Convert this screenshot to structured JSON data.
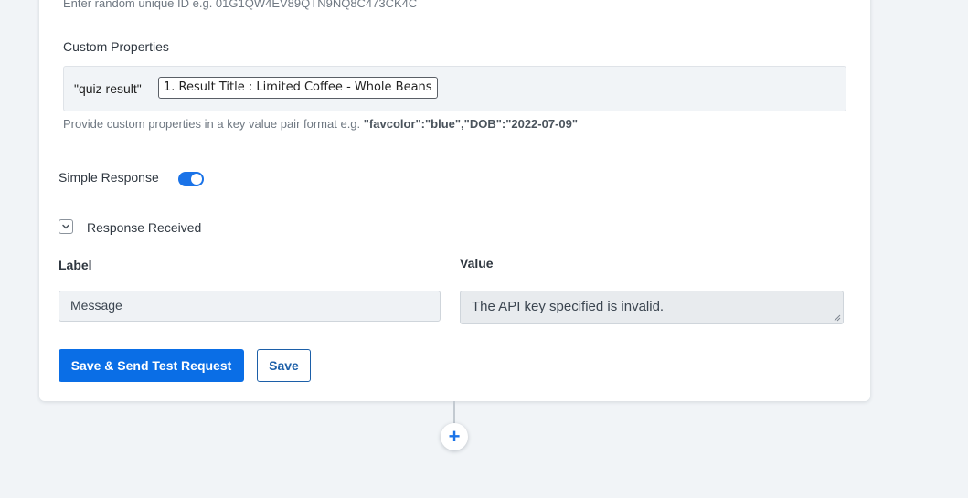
{
  "id_field": {
    "hint": "Enter random unique ID e.g. 01G1QW4EV89QTN9NQ8C473CK4C"
  },
  "custom_properties": {
    "label": "Custom Properties",
    "key": "\"quiz result\"",
    "value_chip": "1. Result Title : Limited Coffee - Whole Beans",
    "help_prefix": "Provide custom properties in a key value pair format e.g. ",
    "help_example": "\"favcolor\":\"blue\",\"DOB\":\"2022-07-09\""
  },
  "simple_response": {
    "label": "Simple Response",
    "enabled": true
  },
  "response_received": {
    "title": "Response Received",
    "label_header": "Label",
    "value_header": "Value",
    "label_value": "Message",
    "value_value": "The API key specified is invalid."
  },
  "actions": {
    "primary_label": "Save & Send Test Request",
    "secondary_label": "Save",
    "add_step_symbol": "+"
  },
  "colors": {
    "accent": "#0a6ee6",
    "toggle_on": "#1a73e8",
    "page_bg": "#f1f4f7"
  }
}
